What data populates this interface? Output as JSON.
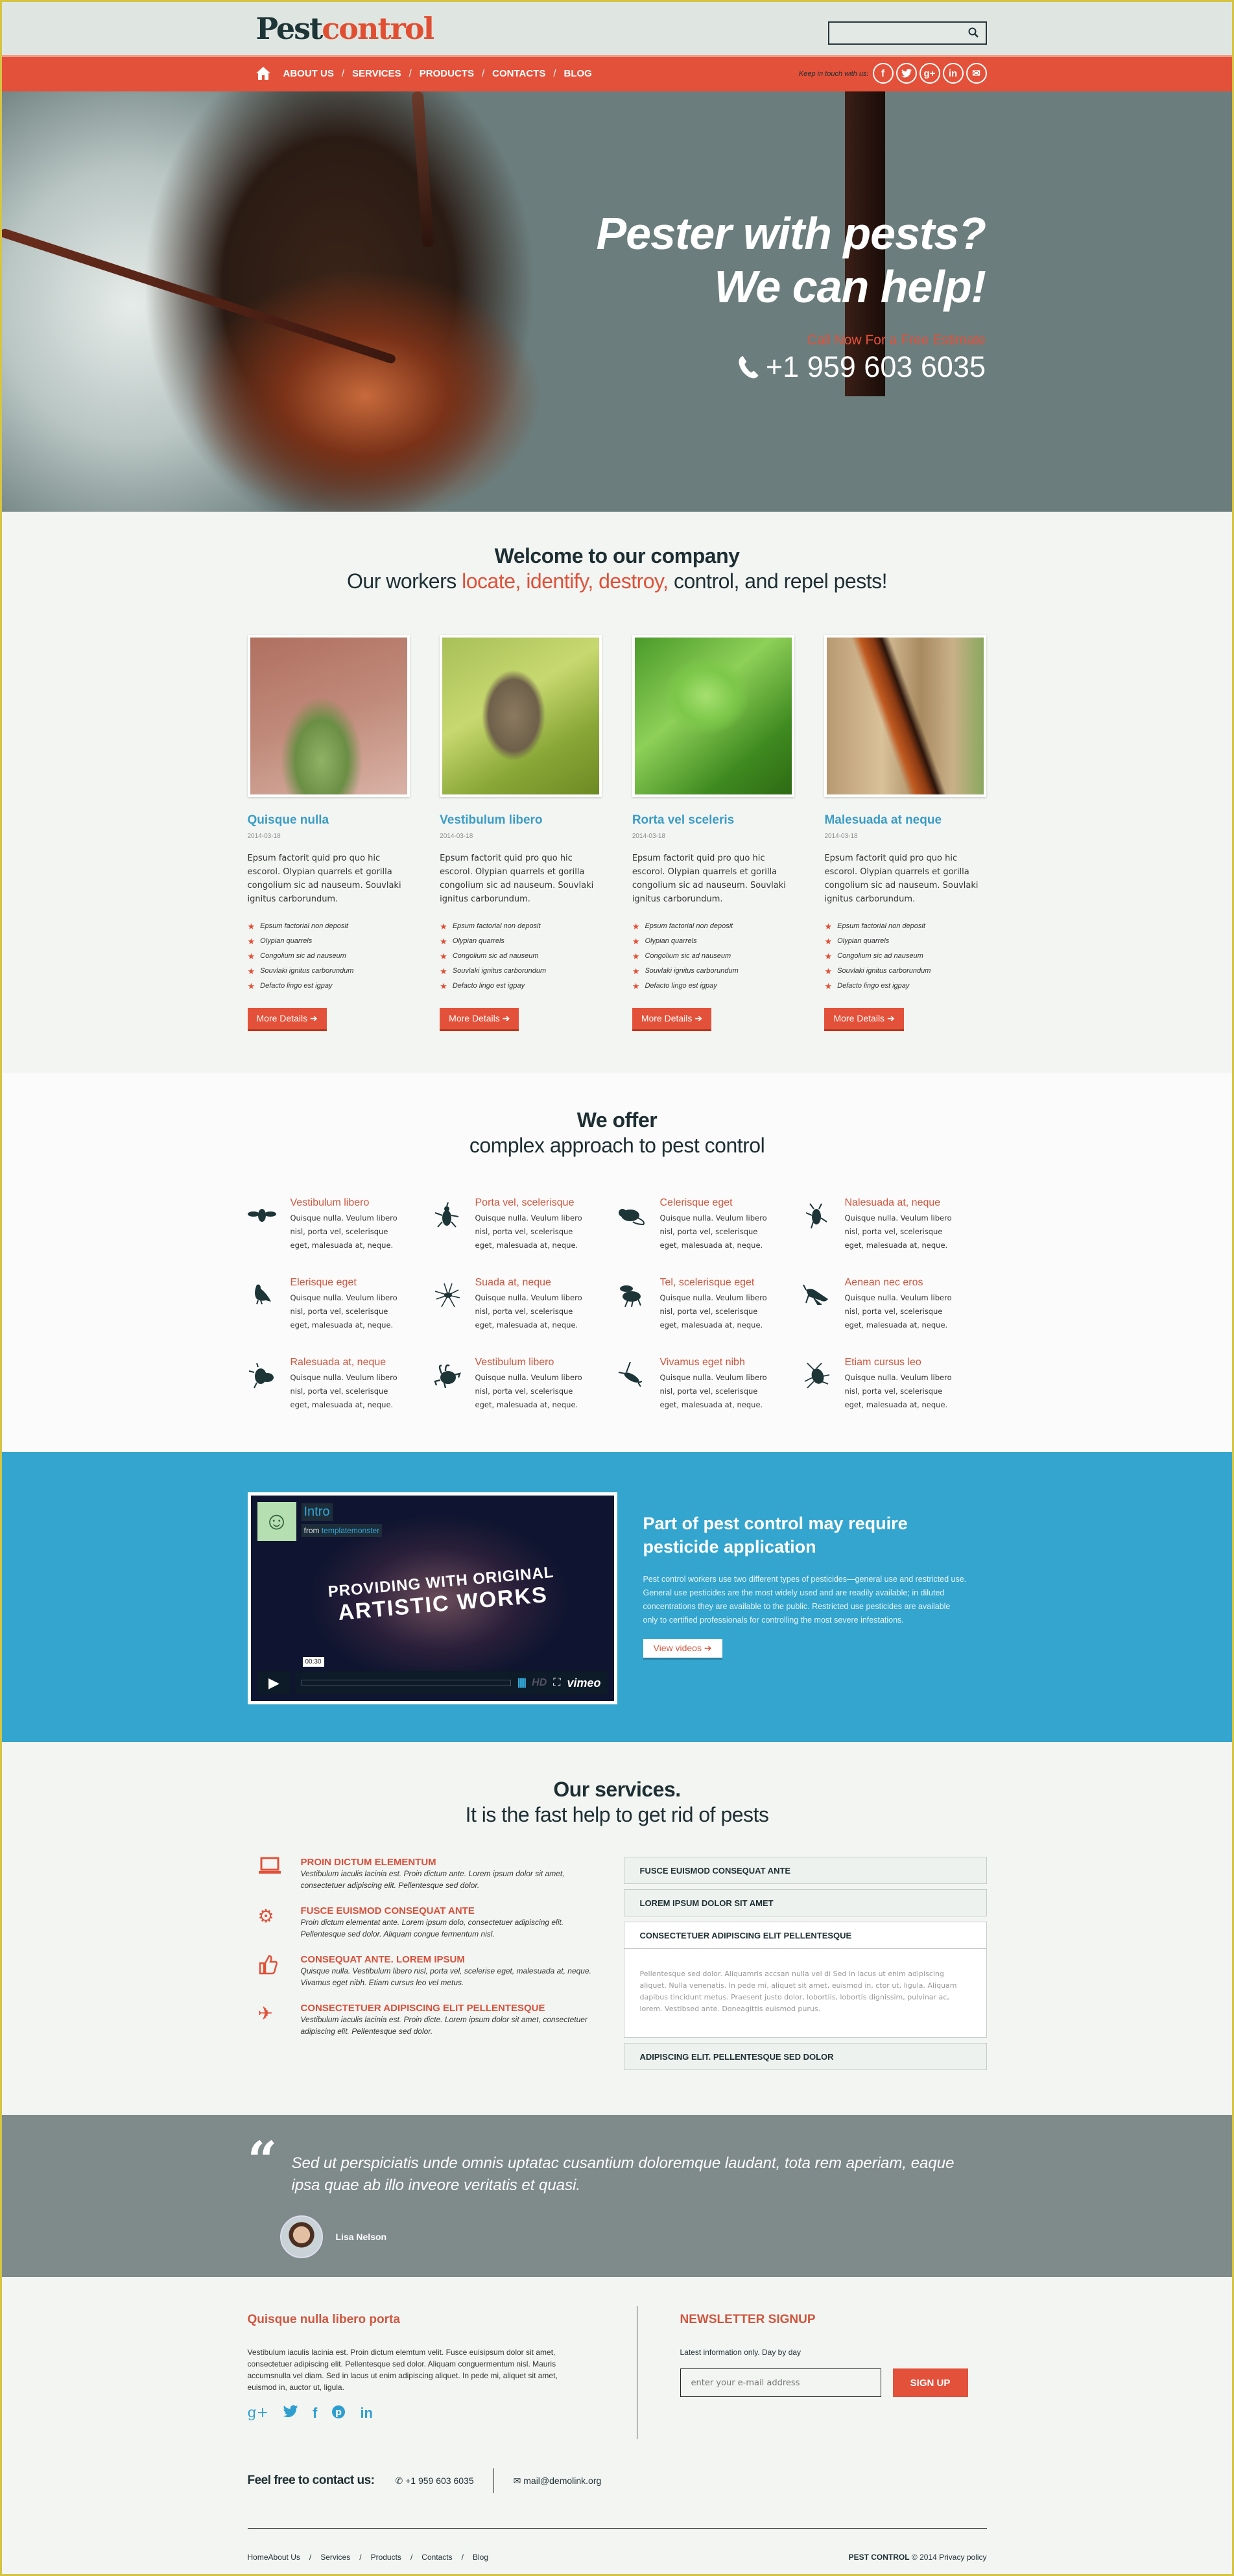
{
  "header": {
    "logo_part1": "Pest",
    "logo_part2": "control",
    "search_placeholder": "",
    "nav": [
      "ABOUT US",
      "SERVICES",
      "PRODUCTS",
      "CONTACTS",
      "BLOG"
    ],
    "keep_in_touch": "Keep in touch with us:",
    "social": [
      {
        "icon": "facebook-icon",
        "glyph": "f"
      },
      {
        "icon": "twitter-icon",
        "glyph": "t"
      },
      {
        "icon": "google-plus-icon",
        "glyph": "g+"
      },
      {
        "icon": "linkedin-icon",
        "glyph": "in"
      },
      {
        "icon": "mail-icon",
        "glyph": "✉"
      }
    ],
    "colors": {
      "brand_red": "#e4513a",
      "brand_dark": "#1e3538",
      "accent_blue": "#34a5ce"
    }
  },
  "hero": {
    "line1": "Pester with pests?",
    "line2": "We can help!",
    "cta": "Call Now For a Free Estimate",
    "phone": "+1 959 603 6035"
  },
  "welcome": {
    "title": "Welcome to our company",
    "sub_prefix": "Our workers ",
    "sub_highlight": "locate, identify, destroy,",
    "sub_suffix": " control, and repel pests!",
    "cards": [
      {
        "title": "Quisque nulla",
        "date": "2014-03-18",
        "text": "Epsum factorit quid pro quo hic escorol. Olypian quarrels et gorilla congolium sic ad nauseum. Souvlaki ignitus carborundum.",
        "bullets": [
          "Epsum factorial non deposit",
          "Olypian quarrels",
          "Congolium sic ad nauseum",
          "Souvlaki ignitus carborundum",
          "Defacto lingo est igpay"
        ],
        "button": "More Details"
      },
      {
        "title": "Vestibulum libero",
        "date": "2014-03-18",
        "text": "Epsum factorit quid pro quo hic escorol. Olypian quarrels et gorilla congolium sic ad nauseum. Souvlaki ignitus carborundum.",
        "bullets": [
          "Epsum factorial non deposit",
          "Olypian quarrels",
          "Congolium sic ad nauseum",
          "Souvlaki ignitus carborundum",
          "Defacto lingo est igpay"
        ],
        "button": "More Details"
      },
      {
        "title": "Rorta vel sceleris",
        "date": "2014-03-18",
        "text": "Epsum factorit quid pro quo hic escorol. Olypian quarrels et gorilla congolium sic ad nauseum. Souvlaki ignitus carborundum.",
        "bullets": [
          "Epsum factorial non deposit",
          "Olypian quarrels",
          "Congolium sic ad nauseum",
          "Souvlaki ignitus carborundum",
          "Defacto lingo est igpay"
        ],
        "button": "More Details"
      },
      {
        "title": "Malesuada at neque",
        "date": "2014-03-18",
        "text": "Epsum factorit quid pro quo hic escorol. Olypian quarrels et gorilla congolium sic ad nauseum. Souvlaki ignitus carborundum.",
        "bullets": [
          "Epsum factorial non deposit",
          "Olypian quarrels",
          "Congolium sic ad nauseum",
          "Souvlaki ignitus carborundum",
          "Defacto lingo est igpay"
        ],
        "button": "More Details"
      }
    ]
  },
  "offer": {
    "title": "We offer",
    "subtitle": "complex approach to pest control",
    "items": [
      {
        "icon": "fly-icon",
        "title": "Vestibulum libero",
        "text": "Quisque nulla. Veulum libero nisl, porta vel, scelerisque eget, malesuada at, neque."
      },
      {
        "icon": "beetle-icon",
        "title": "Porta vel, scelerisque",
        "text": "Quisque nulla. Veulum libero nisl, porta vel, scelerisque eget, malesuada at, neque."
      },
      {
        "icon": "rat-icon",
        "title": "Celerisque eget",
        "text": "Quisque nulla. Veulum libero nisl, porta vel, scelerisque eget, malesuada at, neque."
      },
      {
        "icon": "cockroach-icon",
        "title": "Nalesuada at, neque",
        "text": "Quisque nulla. Veulum libero nisl, porta vel, scelerisque eget, malesuada at, neque."
      },
      {
        "icon": "pigeon-icon",
        "title": "Elerisque eget",
        "text": "Quisque nulla. Veulum libero nisl, porta vel, scelerisque eget, malesuada at, neque."
      },
      {
        "icon": "spider-icon",
        "title": "Suada at, neque",
        "text": "Quisque nulla. Veulum libero nisl, porta vel, scelerisque eget, malesuada at, neque."
      },
      {
        "icon": "wasp-icon",
        "title": "Tel, scelerisque eget",
        "text": "Quisque nulla. Veulum libero nisl, porta vel, scelerisque eget, malesuada at, neque."
      },
      {
        "icon": "grasshopper-icon",
        "title": "Aenean nec eros",
        "text": "Quisque nulla. Veulum libero nisl, porta vel, scelerisque eget, malesuada at, neque."
      },
      {
        "icon": "housefly-icon",
        "title": "Ralesuada at, neque",
        "text": "Quisque nulla. Veulum libero nisl, porta vel, scelerisque eget, malesuada at, neque."
      },
      {
        "icon": "tick-icon",
        "title": "Vestibulum libero",
        "text": "Quisque nulla. Veulum libero nisl, porta vel, scelerisque eget, malesuada at, neque."
      },
      {
        "icon": "earwig-icon",
        "title": "Vivamus eget nibh",
        "text": "Quisque nulla. Veulum libero nisl, porta vel, scelerisque eget, malesuada at, neque."
      },
      {
        "icon": "roach-icon",
        "title": "Etiam cursus leo",
        "text": "Quisque nulla. Veulum libero nisl, porta vel, scelerisque eget, malesuada at, neque."
      }
    ]
  },
  "video": {
    "player": {
      "title": "Intro",
      "from_label": "from",
      "author": "templatemonster",
      "headline1": "PROVIDING WITH ORIGINAL",
      "headline2": "ARTISTIC WORKS",
      "time": "00:30",
      "hd": "HD",
      "brand": "vimeo"
    },
    "title": "Part of pest control may require pesticide application",
    "text": "Pest control workers use two different types of pesticides—general use and restricted use. General use pesticides are the most widely used and are readily available; in diluted concentrations they are available to the public. Restricted use pesticides are available only to certified professionals for controlling the most severe infestations.",
    "button": "View videos"
  },
  "services": {
    "title": "Our services.",
    "subtitle": "It is the fast help to get rid of pests",
    "items": [
      {
        "icon": "laptop-icon",
        "title": "PROIN DICTUM ELEMENTUM",
        "text": "Vestibulum iaculis lacinia est. Proin dictum ante. Lorem ipsum dolor sit amet, consectetuer adipiscing elit. Pellentesque sed dolor."
      },
      {
        "icon": "gears-icon",
        "title": "FUSCE EUISMOD CONSEQUAT ANTE",
        "text": "Proin dictum elementat ante. Lorem ipsum dolo, consectetuer adipiscing elit. Pellentesque sed dolor. Aliquam congue fermentum nisl."
      },
      {
        "icon": "thumbs-up-icon",
        "title": "CONSEQUAT ANTE. LOREM IPSUM",
        "text": "Quisque nulla. Vestibulum libero nisl, porta vel, scelerise eget, malesuada at, neque. Vivamus eget nibh. Etiam cursus leo vel metus."
      },
      {
        "icon": "plane-icon",
        "title": "CONSECTETUER ADIPISCING ELIT PELLENTESQUE",
        "text": "Vestibulum iaculis lacinia est. Proin dicte. Lorem ipsum dolor sit amet, consectetuer adipiscing elit. Pellentesque sed dolor."
      }
    ],
    "accordion": [
      {
        "title": "FUSCE EUISMOD CONSEQUAT ANTE",
        "open": false
      },
      {
        "title": "LOREM IPSUM DOLOR SIT AMET",
        "open": false
      },
      {
        "title": "CONSECTETUER ADIPISCING ELIT PELLENTESQUE",
        "open": true,
        "body": "Pellentesque sed dolor. Aliquamris accsan nulla vel di Sed in lacus ut enim adipiscing aliquet. Nulla venenatis. In pede mi, aliquet sit amet, euismod in, ctor ut, ligula. Aliquam dapibus tincidunt metus. Praesent justo dolor, lobortiis, lobortis dignissim, pulvinar ac, lorem. Vestibsed ante. Doneagittis euismod purus."
      },
      {
        "title": "ADIPISCING ELIT. PELLENTESQUE SED DOLOR",
        "open": false
      }
    ]
  },
  "testimonial": {
    "quote": "Sed ut perspiciatis unde omnis uptatac cusantium doloremque laudant, tota rem aperiam, eaque ipsa quae ab illo inveore veritatis et quasi.",
    "author": "Lisa Nelson"
  },
  "footer": {
    "about_title": "Quisque nulla libero porta",
    "about_text": "Vestibulum iaculis lacinia est. Proin dictum elemtum velit. Fusce euisipsum dolor sit amet, consectetuer adipiscing elit. Pellentesque sed dolor. Aliquam conguermentum nisl. Mauris accumsnulla vel diam. Sed in lacus ut enim adipiscing aliquet. In pede mi, aliquet sit amet, euismod in, auctor ut, ligula.",
    "social": [
      {
        "icon": "google-plus-icon",
        "glyph": "g+"
      },
      {
        "icon": "twitter-icon",
        "glyph": "🐦"
      },
      {
        "icon": "facebook-icon",
        "glyph": "f"
      },
      {
        "icon": "pinterest-icon",
        "glyph": "℗"
      },
      {
        "icon": "linkedin-icon",
        "glyph": "in"
      }
    ],
    "newsletter_title": "NEWSLETTER SIGNUP",
    "newsletter_sub": "Latest information only. Day by day",
    "email_placeholder": "enter your e-mail address",
    "signup": "SIGN UP",
    "contact_label": "Feel free to contact us:",
    "phone": "+1 959 603 6035",
    "email": "mail@demolink.org",
    "links": [
      "HomeAbout Us",
      "Services",
      "Products",
      "Contacts",
      "Blog"
    ],
    "brand": "PEST CONTROL",
    "copyright": "© 2014",
    "privacy": "Privacy policy"
  }
}
